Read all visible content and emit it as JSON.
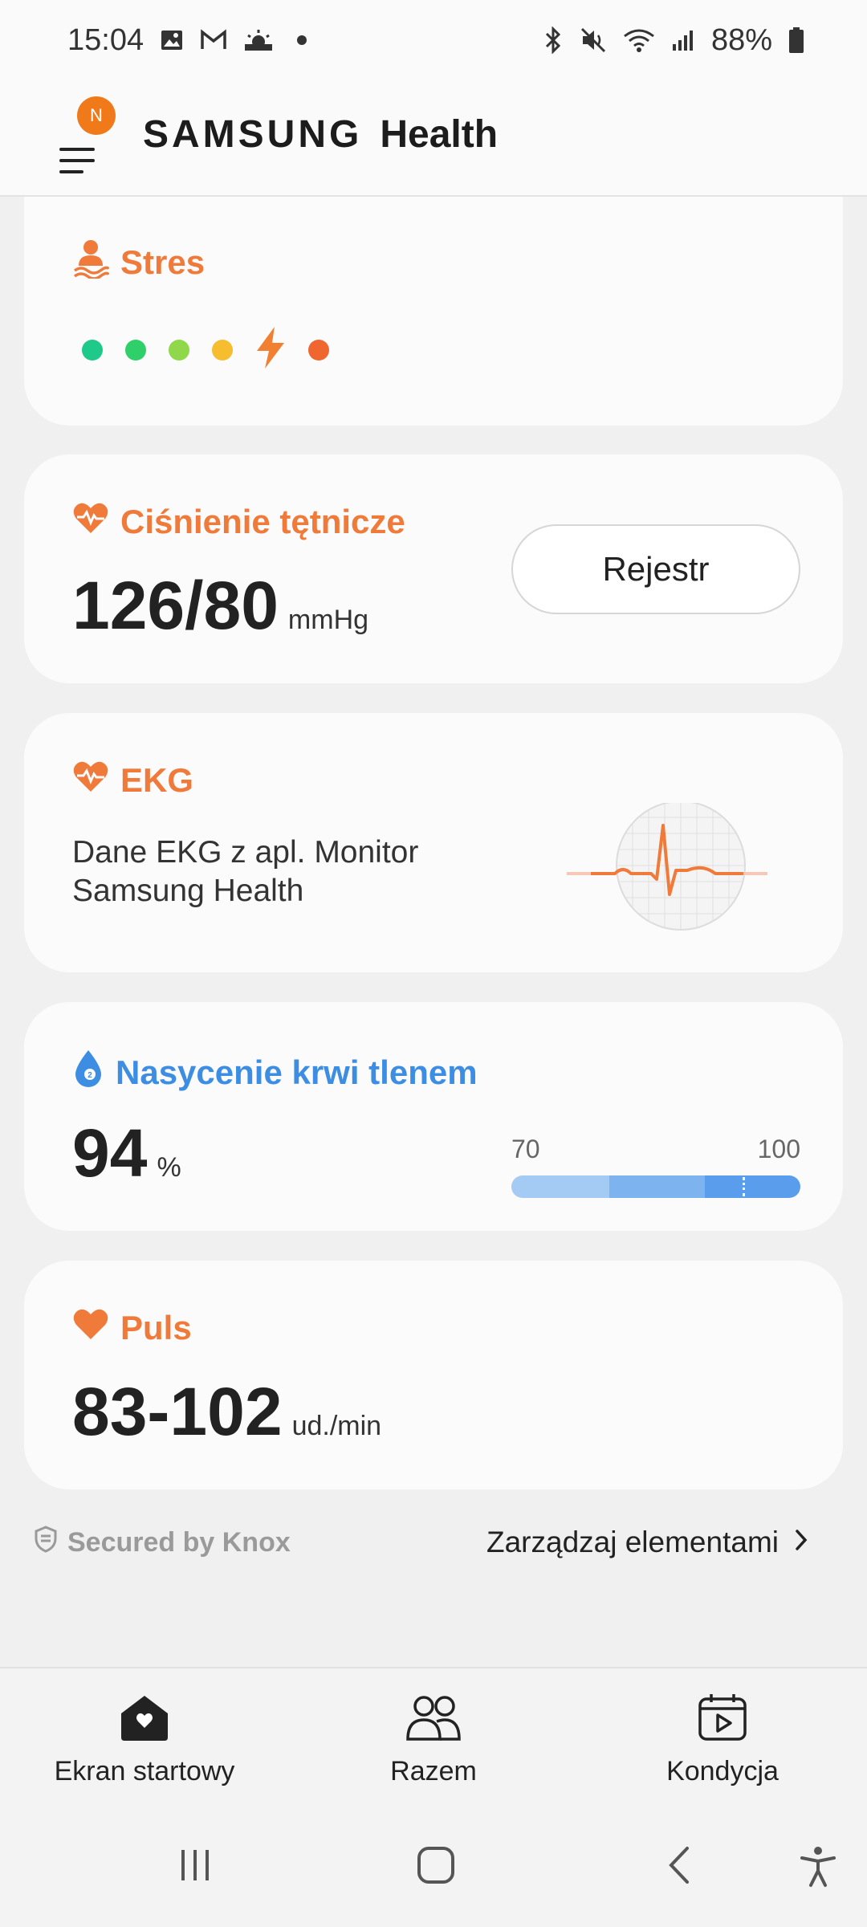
{
  "status_bar": {
    "time": "15:04",
    "battery": "88%",
    "left_icons": [
      "gallery-icon",
      "gmail-icon",
      "weather-icon",
      "dot-icon"
    ],
    "right_icons": [
      "bluetooth-icon",
      "mute-icon",
      "wifi-icon",
      "signal-icon",
      "battery-icon"
    ]
  },
  "header": {
    "badge": "N",
    "brand_samsung": "SAMSUNG",
    "brand_health": "Health"
  },
  "cards": {
    "stress": {
      "title": "Stres",
      "level_colors": [
        "#1ec98a",
        "#2fd06a",
        "#8fd84a",
        "#f6bd2e",
        "#f28033",
        "#f0662f"
      ],
      "current_level_index": 4
    },
    "blood_pressure": {
      "title": "Ciśnienie tętnicze",
      "value": "126/80",
      "unit": "mmHg",
      "button": "Rejestr"
    },
    "ekg": {
      "title": "EKG",
      "description": "Dane EKG z apl. Monitor Samsung Health"
    },
    "spo2": {
      "title": "Nasycenie krwi tlenem",
      "value": "94",
      "unit": "%",
      "scale_min": "70",
      "scale_max": "100",
      "current_fraction": 0.8
    },
    "pulse": {
      "title": "Puls",
      "value": "83-102",
      "unit": "ud./min"
    }
  },
  "footer": {
    "knox": "Secured by Knox",
    "manage": "Zarządzaj elementami"
  },
  "bottom_nav": [
    {
      "label": "Ekran startowy",
      "icon": "home-icon"
    },
    {
      "label": "Razem",
      "icon": "together-icon"
    },
    {
      "label": "Kondycja",
      "icon": "fitness-icon"
    }
  ],
  "colors": {
    "accent_orange": "#ef7a3a",
    "accent_blue": "#3d8ee3"
  }
}
